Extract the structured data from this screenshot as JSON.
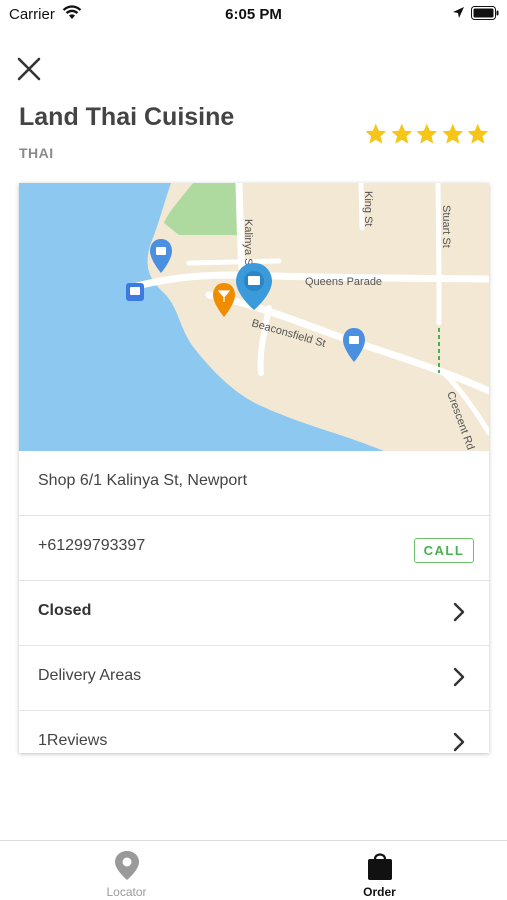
{
  "status_bar": {
    "carrier": "Carrier",
    "time": "6:05 PM"
  },
  "header": {
    "title": "Land Thai Cuisine",
    "cuisine": "THAI",
    "rating_stars": 5,
    "star_color": "#f5c518"
  },
  "map": {
    "streets": [
      "Kalinya St",
      "King St",
      "Stuart St",
      "Queens Parade",
      "Beaconsfield St",
      "Crescent Rd"
    ],
    "colors": {
      "water": "#8cc8f0",
      "land": "#f2e8d4",
      "park": "#aedaa0"
    }
  },
  "details": {
    "address": "Shop 6/1 Kalinya St, Newport",
    "phone": "+61299793397",
    "call_label": "CALL",
    "hours_status": "Closed",
    "delivery_label": "Delivery Areas",
    "reviews_label": "1Reviews"
  },
  "tabbar": {
    "tabs": [
      {
        "label": "Locator",
        "icon": "map-pin-icon",
        "active": false
      },
      {
        "label": "Order",
        "icon": "shopping-bag-icon",
        "active": true
      }
    ]
  }
}
